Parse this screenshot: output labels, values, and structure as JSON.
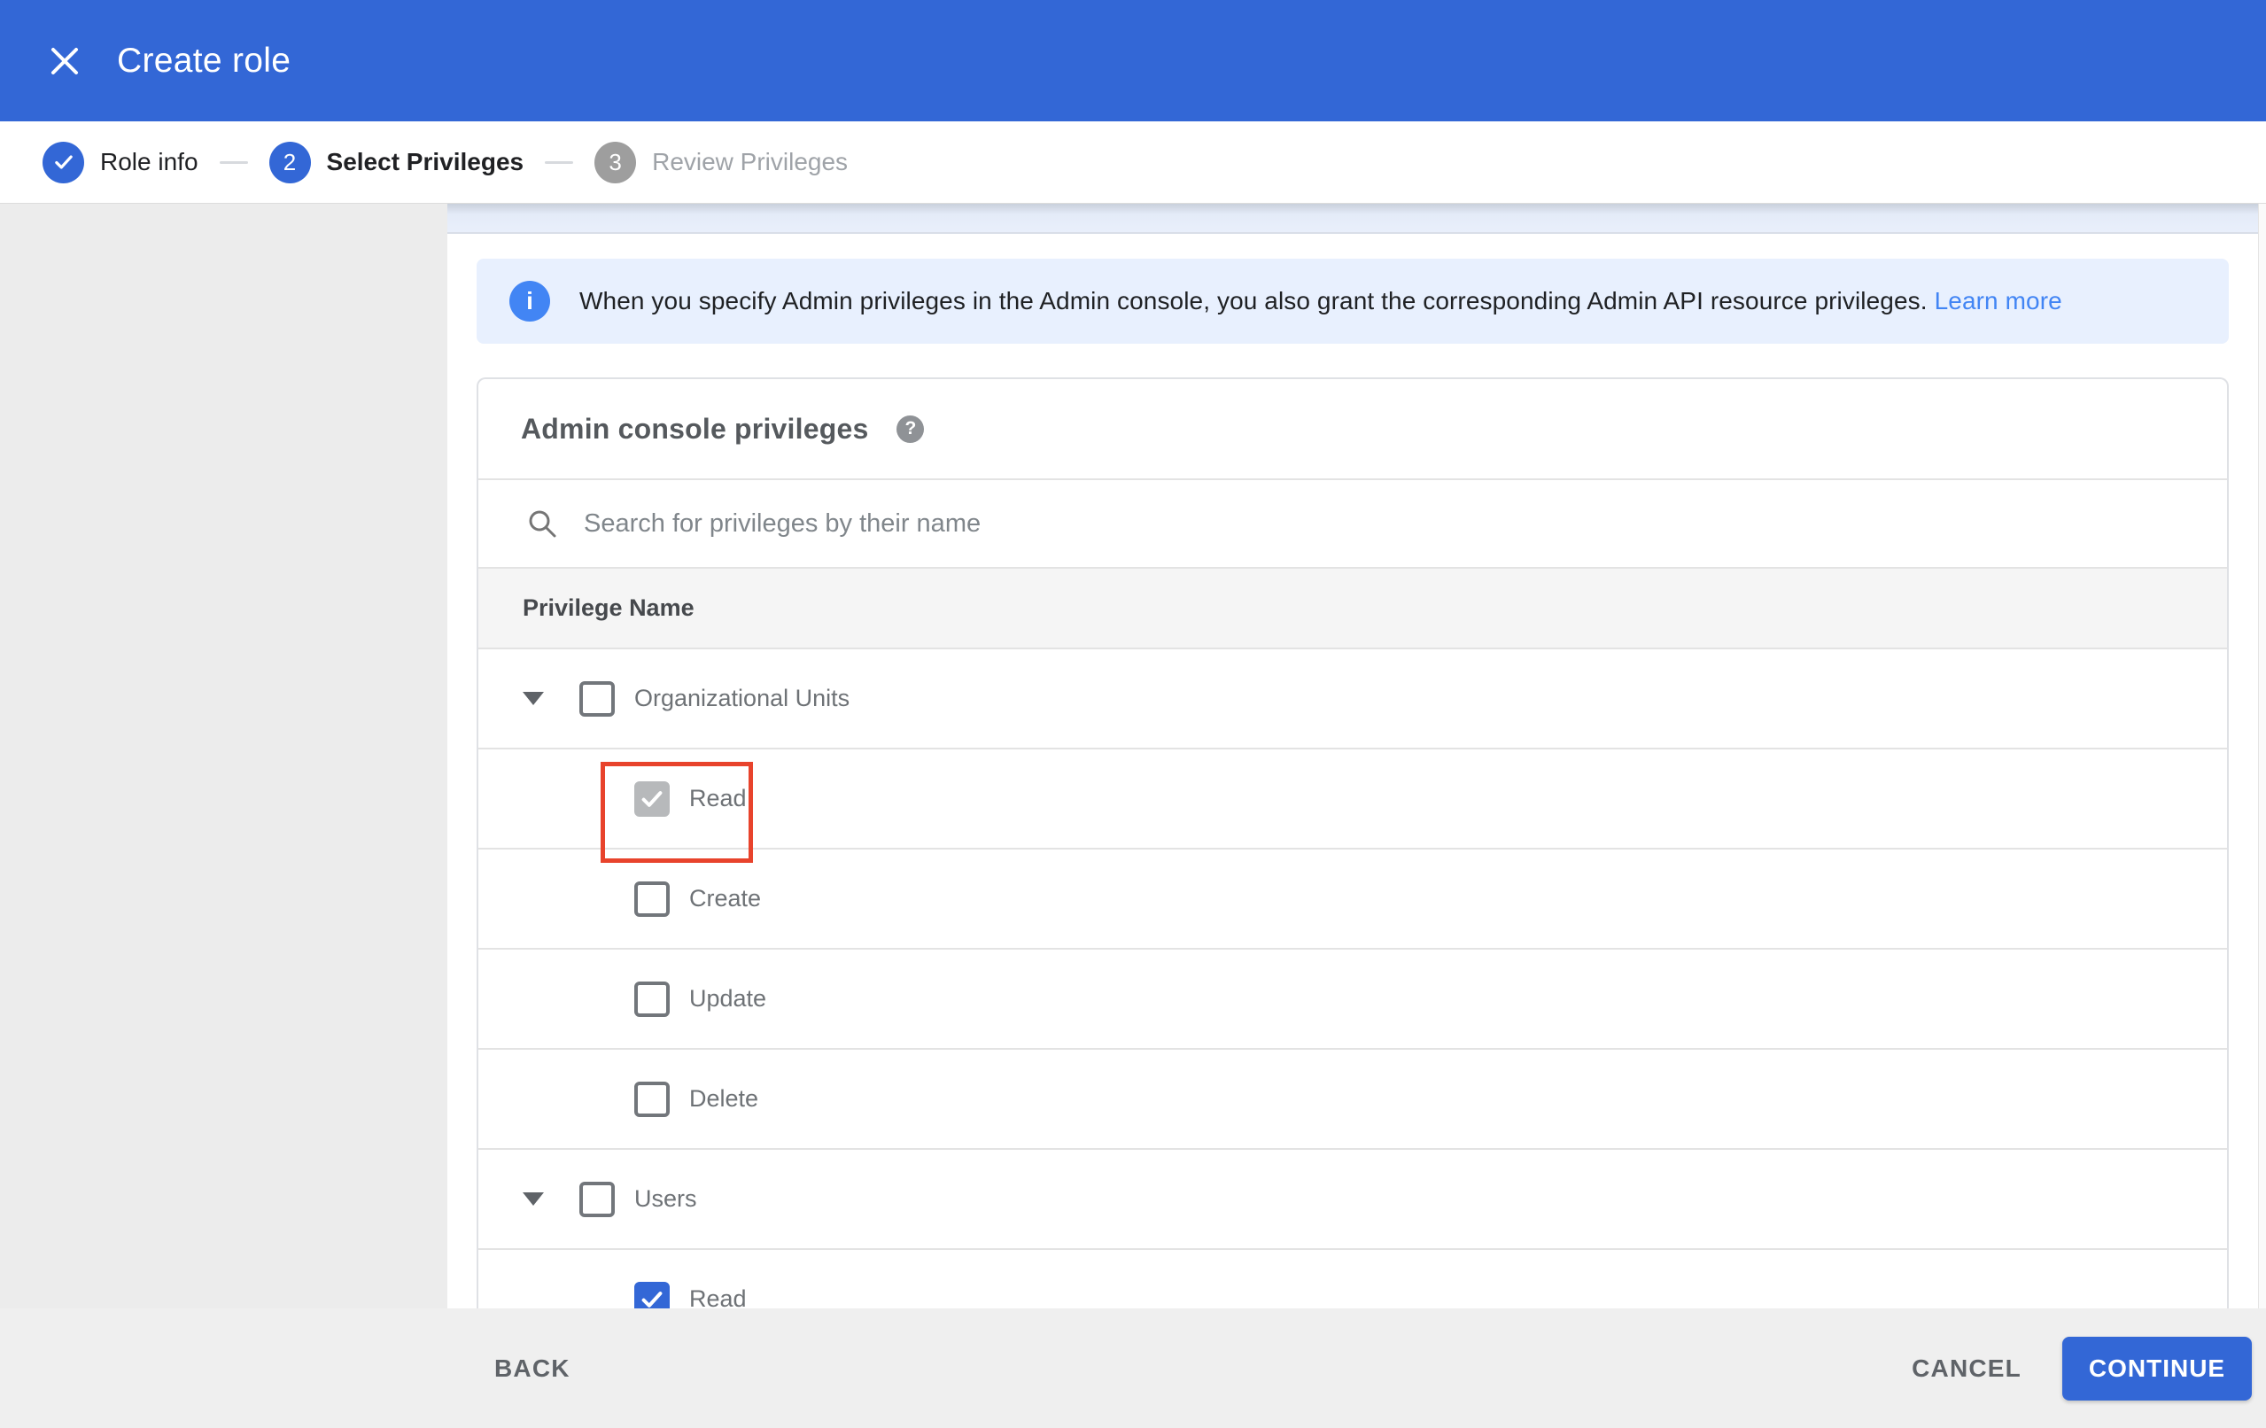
{
  "header": {
    "title": "Create role"
  },
  "icons": {
    "close_glyph": "✕",
    "info_glyph": "i",
    "help_glyph": "?"
  },
  "stepper": {
    "steps": [
      {
        "number": "1",
        "label": "Role info",
        "state": "completed"
      },
      {
        "number": "2",
        "label": "Select Privileges",
        "state": "active"
      },
      {
        "number": "3",
        "label": "Review Privileges",
        "state": "upcoming"
      }
    ]
  },
  "banner": {
    "text": "When you specify Admin privileges in the Admin console, you also grant the corresponding Admin API resource privileges.",
    "link": "Learn more"
  },
  "panel": {
    "title": "Admin console privileges",
    "search_placeholder": "Search for privileges by their name",
    "search_value": "",
    "column_header": "Privilege Name",
    "rows": [
      {
        "label": "Organizational Units",
        "type": "group",
        "expanded": true,
        "checked": false
      },
      {
        "label": "Read",
        "type": "privilege",
        "checked": true,
        "disabled": true,
        "highlighted": true
      },
      {
        "label": "Create",
        "type": "privilege",
        "checked": false
      },
      {
        "label": "Update",
        "type": "privilege",
        "checked": false
      },
      {
        "label": "Delete",
        "type": "privilege",
        "checked": false
      },
      {
        "label": "Users",
        "type": "group",
        "expanded": true,
        "checked": false
      },
      {
        "label": "Read",
        "type": "privilege",
        "checked": true
      }
    ]
  },
  "footer": {
    "back": "BACK",
    "cancel": "CANCEL",
    "continue": "CONTINUE"
  },
  "colors": {
    "header_blue": "#3367d6",
    "info_icon_blue": "#4285f4",
    "banner_bg": "#e8f0fe",
    "highlight_red": "#e8432c",
    "checkbox_checked_gray": "#b7b9bb",
    "checkbox_checked_blue": "#3367d6",
    "footer_bg": "#efefef",
    "sidebar_bg": "#ececec"
  }
}
